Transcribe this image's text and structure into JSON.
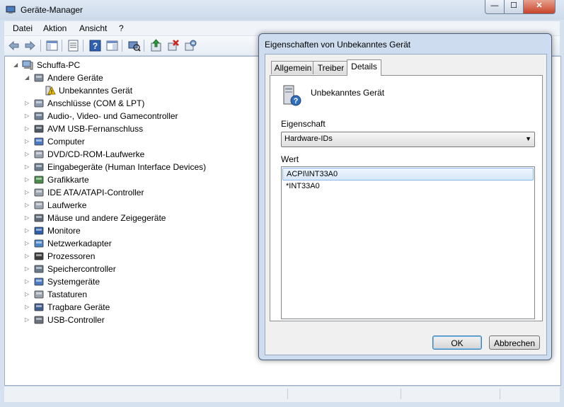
{
  "window": {
    "title": "Geräte-Manager",
    "min_glyph": "—",
    "max_glyph": "☐",
    "close_glyph": "✕"
  },
  "menu": {
    "items": [
      "Datei",
      "Aktion",
      "Ansicht",
      "?"
    ]
  },
  "toolbar": {
    "icons": [
      "back-arrow-icon",
      "forward-arrow-icon",
      "show-hide-console-tree-icon",
      "properties-icon",
      "help-icon",
      "action-pane-icon",
      "scan-hardware-icon",
      "update-driver-icon",
      "uninstall-icon",
      "disable-device-icon"
    ]
  },
  "tree": {
    "root": "Schuffa-PC",
    "items": [
      {
        "label": "Andere Geräte",
        "expanded": true
      },
      {
        "label": "Unbekanntes Gerät",
        "child": true
      },
      {
        "label": "Anschlüsse (COM & LPT)"
      },
      {
        "label": "Audio-, Video- und Gamecontroller"
      },
      {
        "label": "AVM USB-Fernanschluss"
      },
      {
        "label": "Computer"
      },
      {
        "label": "DVD/CD-ROM-Laufwerke"
      },
      {
        "label": "Eingabegeräte (Human Interface Devices)"
      },
      {
        "label": "Grafikkarte"
      },
      {
        "label": "IDE ATA/ATAPI-Controller"
      },
      {
        "label": "Laufwerke"
      },
      {
        "label": "Mäuse und andere Zeigegeräte"
      },
      {
        "label": "Monitore"
      },
      {
        "label": "Netzwerkadapter"
      },
      {
        "label": "Prozessoren"
      },
      {
        "label": "Speichercontroller"
      },
      {
        "label": "Systemgeräte"
      },
      {
        "label": "Tastaturen"
      },
      {
        "label": "Tragbare Geräte"
      },
      {
        "label": "USB-Controller"
      }
    ]
  },
  "dialog": {
    "title": "Eigenschaften von Unbekanntes Gerät",
    "tabs": [
      "Allgemein",
      "Treiber",
      "Details"
    ],
    "active_tab": "Details",
    "device_name": "Unbekanntes Gerät",
    "property_label": "Eigenschaft",
    "property_value": "Hardware-IDs",
    "value_label": "Wert",
    "values": [
      "ACPI\\INT33A0",
      "*INT33A0"
    ],
    "ok_label": "OK",
    "cancel_label": "Abbrechen"
  },
  "colors": {
    "accent": "#3c7fb1",
    "selection": "#d7e8fb",
    "warning": "#f5c400"
  }
}
